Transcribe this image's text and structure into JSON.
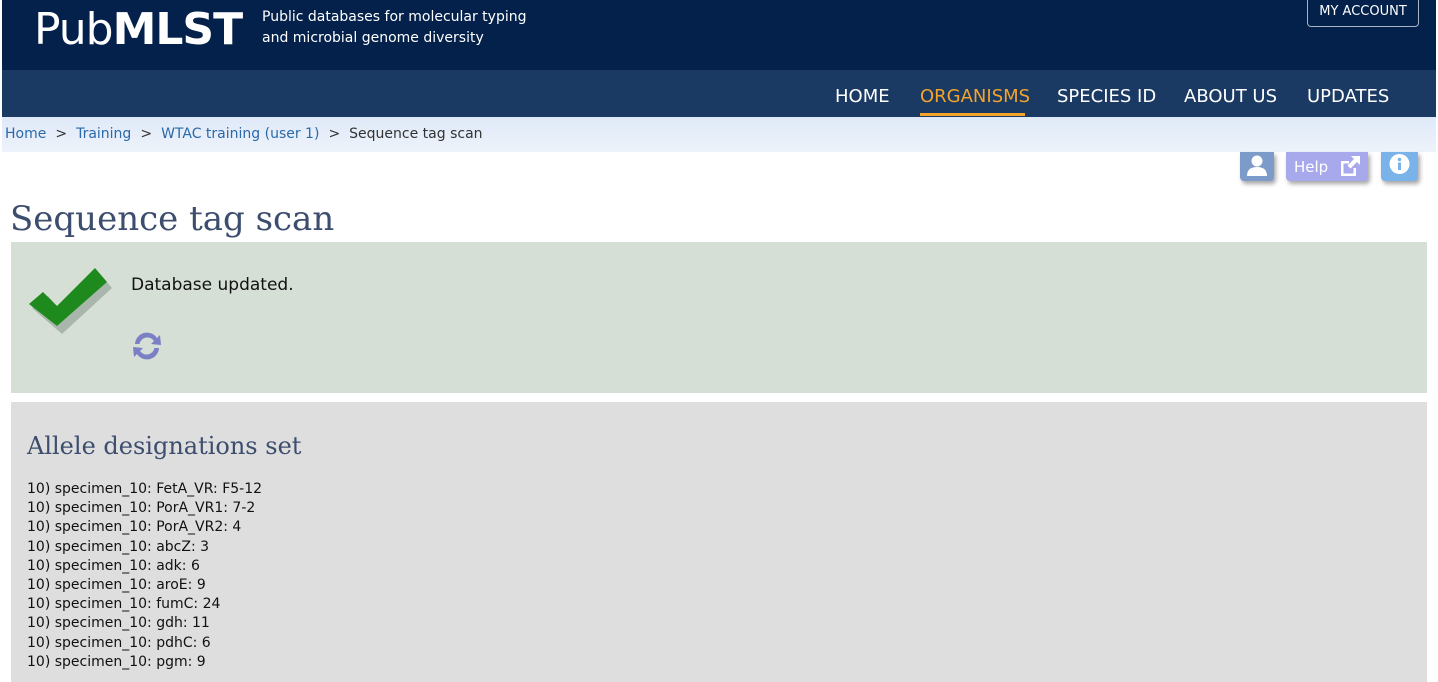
{
  "header": {
    "logo_light": "Pub",
    "logo_bold": "MLST",
    "tagline_line1": "Public databases for molecular typing",
    "tagline_line2": "and microbial genome diversity",
    "account_button": "MY ACCOUNT"
  },
  "nav": {
    "items": [
      {
        "label": "HOME",
        "active": false
      },
      {
        "label": "ORGANISMS",
        "active": true
      },
      {
        "label": "SPECIES ID",
        "active": false
      },
      {
        "label": "ABOUT US",
        "active": false
      },
      {
        "label": "UPDATES",
        "active": false
      }
    ]
  },
  "breadcrumb": {
    "items": [
      "Home",
      "Training",
      "WTAC training (user 1)"
    ],
    "separator": ">",
    "current": "Sequence tag scan"
  },
  "toolbar": {
    "help_label": "Help"
  },
  "page": {
    "title": "Sequence tag scan"
  },
  "status": {
    "message": "Database updated."
  },
  "designations": {
    "title": "Allele designations set",
    "items": [
      "10) specimen_10: FetA_VR: F5-12",
      "10) specimen_10: PorA_VR1: 7-2",
      "10) specimen_10: PorA_VR2: 4",
      "10) specimen_10: abcZ: 3",
      "10) specimen_10: adk: 6",
      "10) specimen_10: aroE: 9",
      "10) specimen_10: fumC: 24",
      "10) specimen_10: gdh: 11",
      "10) specimen_10: pdhC: 6",
      "10) specimen_10: pgm: 9"
    ]
  },
  "colors": {
    "header_bg": "#03214a",
    "nav_bg": "#1b3a63",
    "nav_active": "#f2a42c",
    "success_bg": "#d5dfd6",
    "checkmark": "#1e8a1e",
    "refresh_icon": "#7b7fc6",
    "section_bg": "#dedede"
  }
}
